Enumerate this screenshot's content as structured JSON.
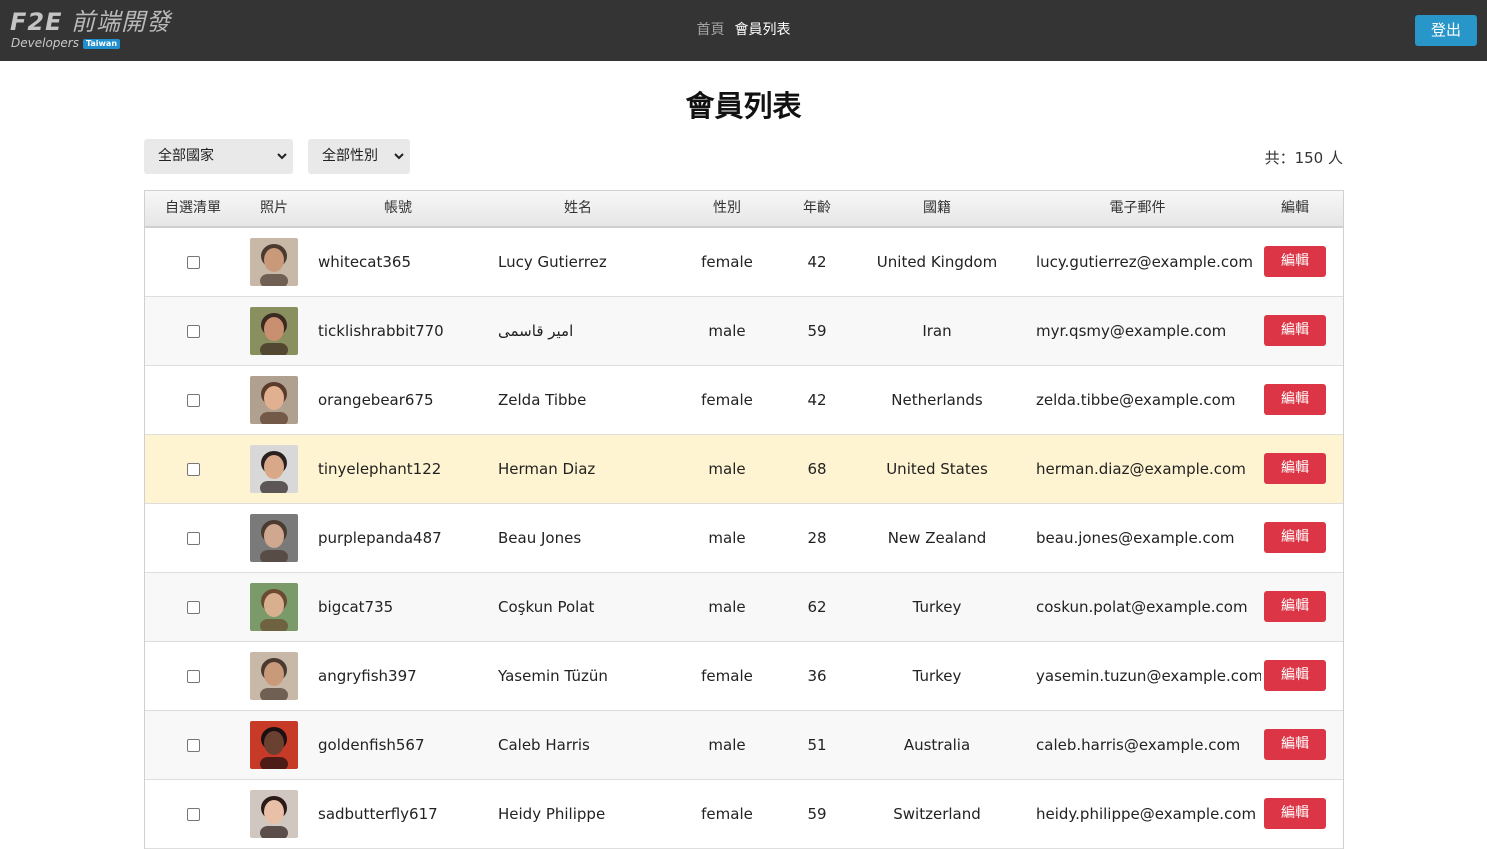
{
  "header": {
    "logo_main_prefix": "F2E",
    "logo_main_rest": " 前端開發",
    "logo_sub": "Developers",
    "logo_badge": "Taiwan",
    "nav_home": "首頁",
    "nav_current": "會員列表",
    "logout_label": "登出"
  },
  "page": {
    "title": "會員列表",
    "country_filter": "全部國家",
    "gender_filter": "全部性別",
    "total_text": "共：150 人"
  },
  "table": {
    "headers": [
      "自選清單",
      "照片",
      "帳號",
      "姓名",
      "性別",
      "年齡",
      "國籍",
      "電子郵件",
      "編輯"
    ],
    "edit_label": "編輯",
    "rows": [
      {
        "username": "whitecat365",
        "name": "Lucy Gutierrez",
        "gender": "female",
        "age": "42",
        "country": "United Kingdom",
        "email": "lucy.gutierrez@example.com",
        "checked": false,
        "highlight": false
      },
      {
        "username": "ticklishrabbit770",
        "name": "امیر قاسمی",
        "gender": "male",
        "age": "59",
        "country": "Iran",
        "email": "myr.qsmy@example.com",
        "checked": false,
        "highlight": false
      },
      {
        "username": "orangebear675",
        "name": "Zelda Tibbe",
        "gender": "female",
        "age": "42",
        "country": "Netherlands",
        "email": "zelda.tibbe@example.com",
        "checked": false,
        "highlight": false
      },
      {
        "username": "tinyelephant122",
        "name": "Herman Diaz",
        "gender": "male",
        "age": "68",
        "country": "United States",
        "email": "herman.diaz@example.com",
        "checked": false,
        "highlight": true
      },
      {
        "username": "purplepanda487",
        "name": "Beau Jones",
        "gender": "male",
        "age": "28",
        "country": "New Zealand",
        "email": "beau.jones@example.com",
        "checked": false,
        "highlight": false
      },
      {
        "username": "bigcat735",
        "name": "Coşkun Polat",
        "gender": "male",
        "age": "62",
        "country": "Turkey",
        "email": "coskun.polat@example.com",
        "checked": false,
        "highlight": false
      },
      {
        "username": "angryfish397",
        "name": "Yasemin Tüzün",
        "gender": "female",
        "age": "36",
        "country": "Turkey",
        "email": "yasemin.tuzun@example.com",
        "checked": false,
        "highlight": false
      },
      {
        "username": "goldenfish567",
        "name": "Caleb Harris",
        "gender": "male",
        "age": "51",
        "country": "Australia",
        "email": "caleb.harris@example.com",
        "checked": false,
        "highlight": false
      },
      {
        "username": "sadbutterfly617",
        "name": "Heidy Philippe",
        "gender": "female",
        "age": "59",
        "country": "Switzerland",
        "email": "heidy.philippe@example.com",
        "checked": false,
        "highlight": false
      }
    ]
  },
  "colors": {
    "topbar": "#343434",
    "logout": "#2896c8",
    "edit": "#dc3545",
    "highlight_row": "#fff4d2"
  },
  "avatars": [
    {
      "bg": "#c8b8a8",
      "skin": "#c99a7a",
      "hair": "#4a3a30"
    },
    {
      "bg": "#8a8f60",
      "skin": "#c89070",
      "hair": "#3a2a20"
    },
    {
      "bg": "#b0a090",
      "skin": "#e0b090",
      "hair": "#5a3a28"
    },
    {
      "bg": "#d8d8d8",
      "skin": "#d8a888",
      "hair": "#2a2020"
    },
    {
      "bg": "#7a7a7a",
      "skin": "#d0a890",
      "hair": "#4a3a30"
    },
    {
      "bg": "#7a9a6a",
      "skin": "#d8b090",
      "hair": "#6a4a30"
    },
    {
      "bg": "#c8b8a8",
      "skin": "#c99a7a",
      "hair": "#4a3a30"
    },
    {
      "bg": "#c83a28",
      "skin": "#6a4030",
      "hair": "#1a1010"
    },
    {
      "bg": "#d0c8c0",
      "skin": "#e8c0a8",
      "hair": "#2a1a18"
    }
  ]
}
